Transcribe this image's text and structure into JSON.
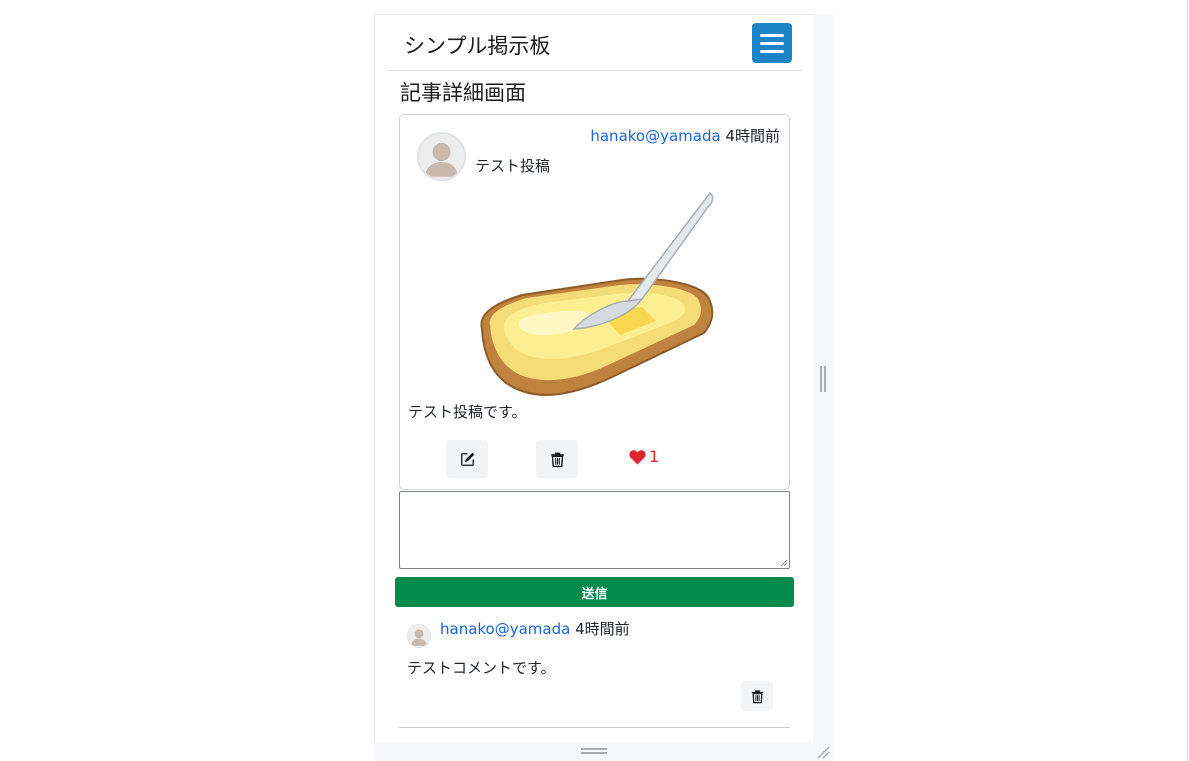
{
  "header": {
    "brand": "シンプル掲示板",
    "menu_icon": "hamburger-menu-icon",
    "accent_color": "#1a84c6"
  },
  "page": {
    "title": "記事詳細画面"
  },
  "post": {
    "user": "hanako@yamada",
    "time": "4時間前",
    "caption": "テスト投稿",
    "image_icon": "buttered-toast-illustration",
    "body": "テスト投稿です。",
    "edit_icon": "edit-icon",
    "delete_icon": "trash-icon",
    "like_count": "1",
    "like_color": "#e0262d"
  },
  "comment_form": {
    "value": "",
    "submit_label": "送信",
    "submit_color": "#008b4c"
  },
  "comments": [
    {
      "user": "hanako@yamada",
      "time": "4時間前",
      "body": "テストコメントです。"
    }
  ],
  "link_color": "#1a66d4"
}
